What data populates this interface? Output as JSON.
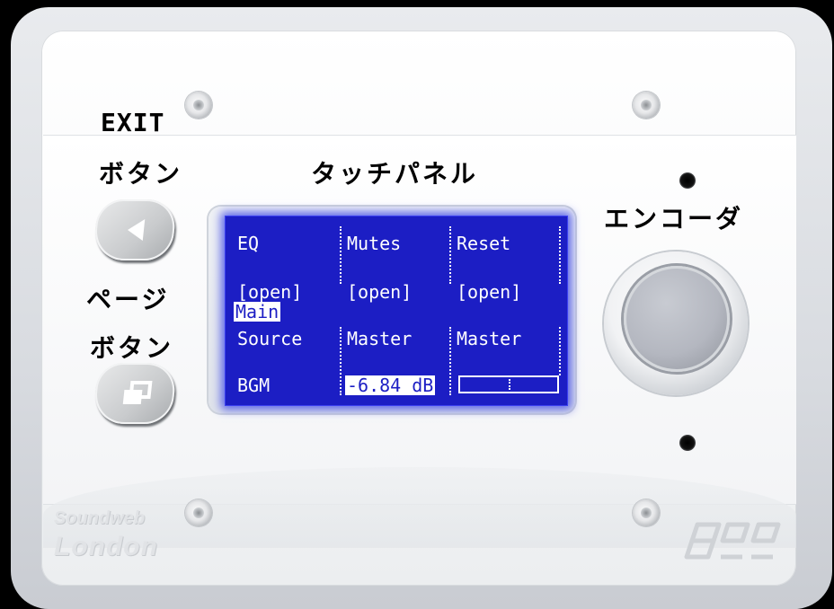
{
  "labels": {
    "exit_title": "EXIT",
    "exit_sub": "ボタン",
    "touch_panel": "タッチパネル",
    "encoder": "エンコーダ",
    "page_title": "ページ",
    "page_sub": "ボタン"
  },
  "screen": {
    "rows": [
      {
        "cells": [
          "EQ",
          "Mutes",
          "Reset"
        ]
      },
      {
        "cells": [
          "[open]",
          "[open]",
          "[open]"
        ]
      },
      {
        "cells": [
          "Source",
          "Master",
          "Master"
        ]
      },
      {
        "cells": [
          "BGM",
          "-6.84 dB",
          ""
        ]
      }
    ],
    "selected_label": "Main",
    "colors": {
      "background": "#1c1ec4",
      "text": "#ffffff"
    }
  },
  "brand": {
    "top": "Soundweb",
    "bottom": "London"
  },
  "icons": {
    "exit_button": "left-triangle-icon",
    "page_button": "pages-icon"
  }
}
